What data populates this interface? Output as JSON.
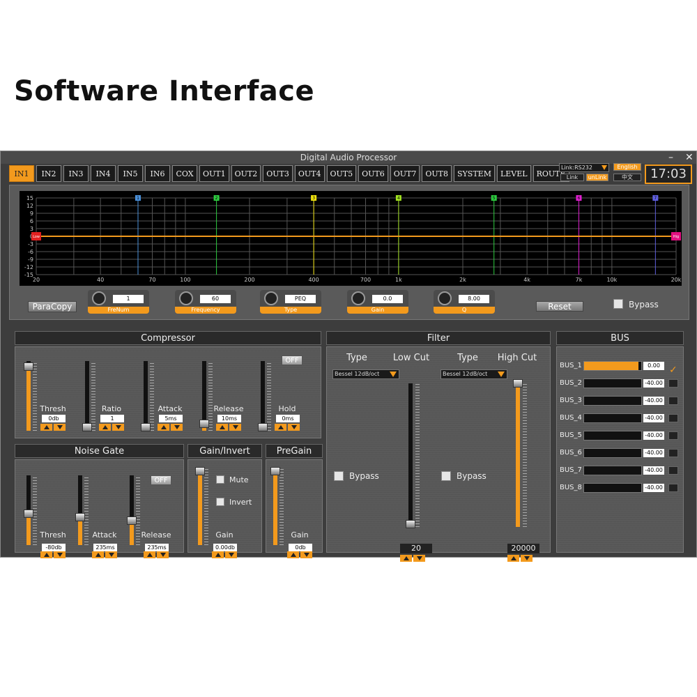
{
  "heading": "Software Interface",
  "window": {
    "title": "Digital Audio Processor",
    "minimize": "–",
    "close": "✕"
  },
  "tabs": [
    "IN1",
    "IN2",
    "IN3",
    "IN4",
    "IN5",
    "IN6",
    "COX",
    "OUT1",
    "OUT2",
    "OUT3",
    "OUT4",
    "OUT5",
    "OUT6",
    "OUT7",
    "OUT8",
    "SYSTEM",
    "LEVEL",
    "ROUTE"
  ],
  "active_tab": "IN1",
  "link": {
    "port": "Link:RS232",
    "link_btn": "Link",
    "unlink_btn": "unLink",
    "lang_en": "English",
    "lang_cn": "中文"
  },
  "clock": "17:03",
  "eq": {
    "y_ticks": [
      "15",
      "12",
      "9",
      "6",
      "3",
      "0",
      "-3",
      "-6",
      "-9",
      "-12",
      "-15"
    ],
    "x_ticks": [
      "20",
      "40",
      "70",
      "100",
      "200",
      "400",
      "700",
      "1k",
      "2k",
      "4k",
      "7k",
      "10k",
      "20k"
    ],
    "bands": [
      {
        "num": "1",
        "freq": 60,
        "color": "#4a90d9"
      },
      {
        "num": "2",
        "freq": 140,
        "color": "#2ecc40"
      },
      {
        "num": "3",
        "freq": 400,
        "color": "#f1e40f"
      },
      {
        "num": "4",
        "freq": 1000,
        "color": "#a0e020"
      },
      {
        "num": "5",
        "freq": 2800,
        "color": "#2ecc40"
      },
      {
        "num": "6",
        "freq": 7000,
        "color": "#e020d0"
      },
      {
        "num": "7",
        "freq": 16000,
        "color": "#6060e0"
      }
    ],
    "lowcut_marker": "Low",
    "highcut_marker": "Hig",
    "paracopy": "ParaCopy",
    "knobs": [
      {
        "label": "FreNum",
        "value": "1"
      },
      {
        "label": "Frequency",
        "value": "60"
      },
      {
        "label": "Type",
        "value": "PEQ"
      },
      {
        "label": "Gain",
        "value": "0.0"
      },
      {
        "label": "Q",
        "value": "8.00"
      }
    ],
    "reset": "Reset",
    "bypass": "Bypass"
  },
  "compressor": {
    "title": "Compressor",
    "off": "OFF",
    "params": [
      {
        "label": "Thresh",
        "value": "0db",
        "level": 0.92
      },
      {
        "label": "Ratio",
        "value": "1",
        "level": 0.05
      },
      {
        "label": "Attack",
        "value": "5ms",
        "level": 0.05
      },
      {
        "label": "Release",
        "value": "10ms",
        "level": 0.1
      },
      {
        "label": "Hold",
        "value": "0ms",
        "level": 0.05
      }
    ]
  },
  "noise_gate": {
    "title": "Noise Gate",
    "off": "OFF",
    "params": [
      {
        "label": "Thresh",
        "value": "-80db",
        "level": 0.45
      },
      {
        "label": "Attack",
        "value": "235ms",
        "level": 0.4
      },
      {
        "label": "Release",
        "value": "235ms",
        "level": 0.35
      }
    ]
  },
  "gain_invert": {
    "title": "Gain/Invert",
    "mute": "Mute",
    "invert": "Invert",
    "label": "Gain",
    "value": "0.00db",
    "level": 0.95
  },
  "pregain": {
    "title": "PreGain",
    "label": "Gain",
    "value": "0db",
    "level": 0.95
  },
  "filter": {
    "title": "Filter",
    "low": {
      "type_label": "Type",
      "cut_label": "Low Cut",
      "type": "Bessel 12dB/oct",
      "bypass": "Bypass",
      "value": "20",
      "level": 0.02
    },
    "high": {
      "type_label": "Type",
      "cut_label": "High Cut",
      "type": "Bessel 12dB/oct",
      "bypass": "Bypass",
      "value": "20000",
      "level": 1.0
    }
  },
  "bus": {
    "title": "BUS",
    "rows": [
      {
        "name": "BUS_1",
        "value": "0.00",
        "level": 0.95,
        "checked": true
      },
      {
        "name": "BUS_2",
        "value": "-40.00",
        "level": 0,
        "checked": false
      },
      {
        "name": "BUS_3",
        "value": "-40.00",
        "level": 0,
        "checked": false
      },
      {
        "name": "BUS_4",
        "value": "-40.00",
        "level": 0,
        "checked": false
      },
      {
        "name": "BUS_5",
        "value": "-40.00",
        "level": 0,
        "checked": false
      },
      {
        "name": "BUS_6",
        "value": "-40.00",
        "level": 0,
        "checked": false
      },
      {
        "name": "BUS_7",
        "value": "-40.00",
        "level": 0,
        "checked": false
      },
      {
        "name": "BUS_8",
        "value": "-40.00",
        "level": 0,
        "checked": false
      }
    ]
  },
  "colors": {
    "accent": "#f39a1d",
    "panel": "#555555",
    "dark": "#1b1b1b"
  }
}
